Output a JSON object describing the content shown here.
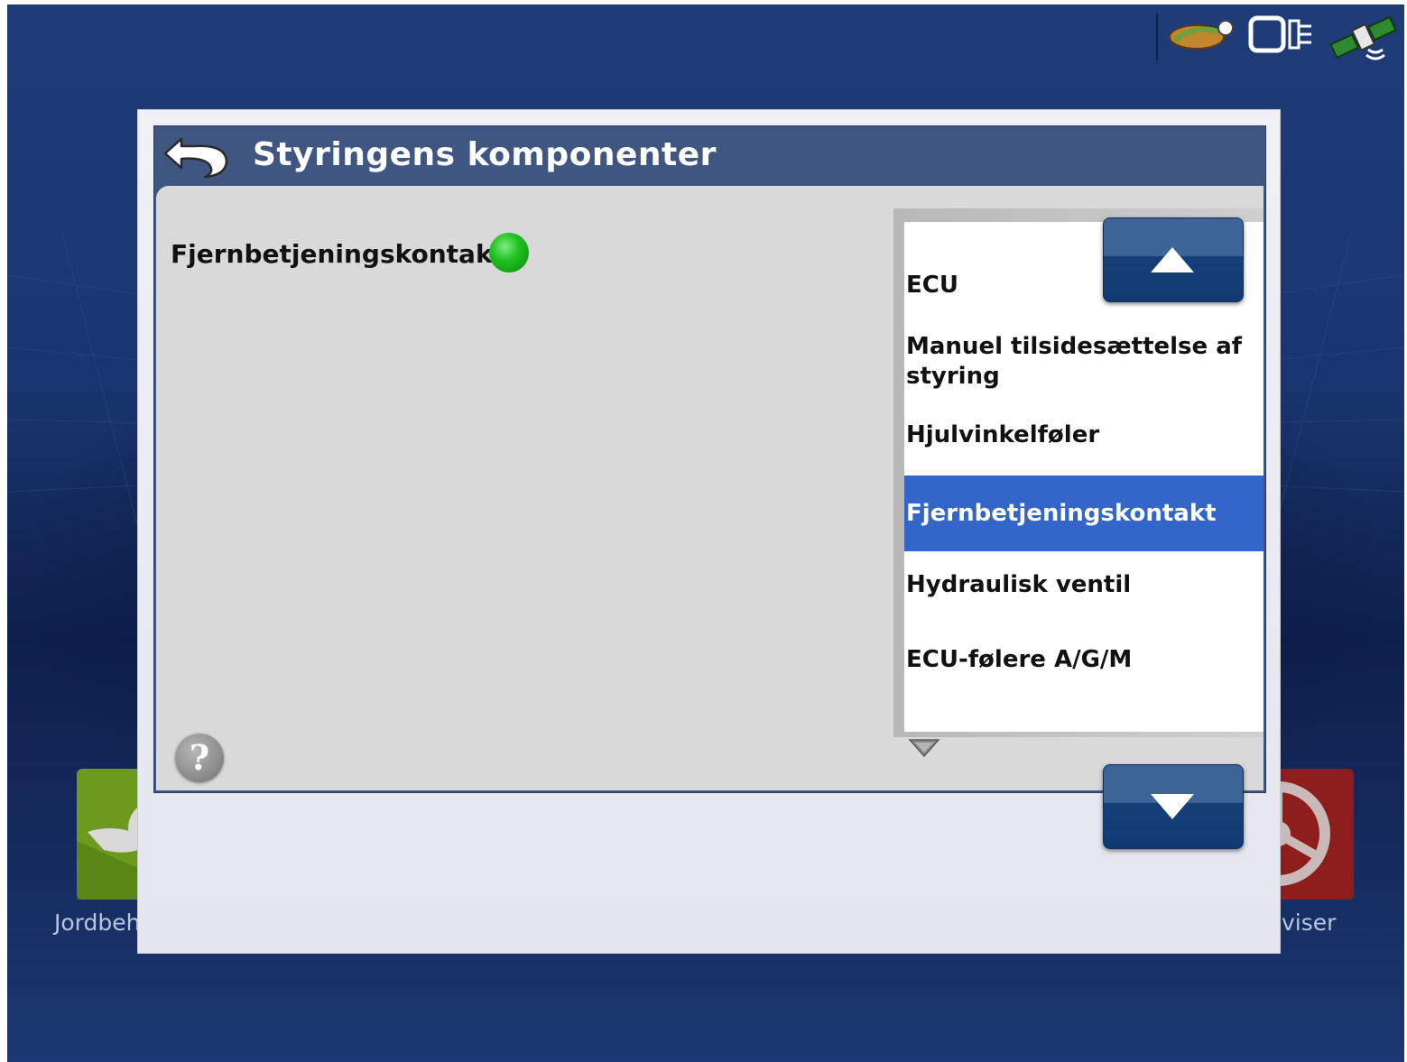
{
  "dialog": {
    "title": "Styringens komponenter",
    "component_label": "Fjernbetjeningskontakt",
    "status_color": "#22c022",
    "help_label": "?"
  },
  "components_list": {
    "items": [
      {
        "label": "ECU",
        "selected": false
      },
      {
        "label": "Manuel tilsidesættelse af styring",
        "selected": false
      },
      {
        "label": "Hjulvinkelføler",
        "selected": false
      },
      {
        "label": "Fjernbetjeningskontakt",
        "selected": true
      },
      {
        "label": "Hydraulisk ventil",
        "selected": false
      },
      {
        "label": "ECU-følere A/G/M",
        "selected": false
      }
    ],
    "selected_color": "#3366c8"
  },
  "background_apps": {
    "left_label": "Jordbeh",
    "right_label": "viser"
  },
  "icons": {
    "back": "back-arrow-icon",
    "help": "help-icon",
    "scroll_up": "triangle-up-icon",
    "scroll_down": "triangle-down-icon",
    "field": "field-icon",
    "display": "display-icon",
    "gps": "gps-satellite-icon"
  }
}
